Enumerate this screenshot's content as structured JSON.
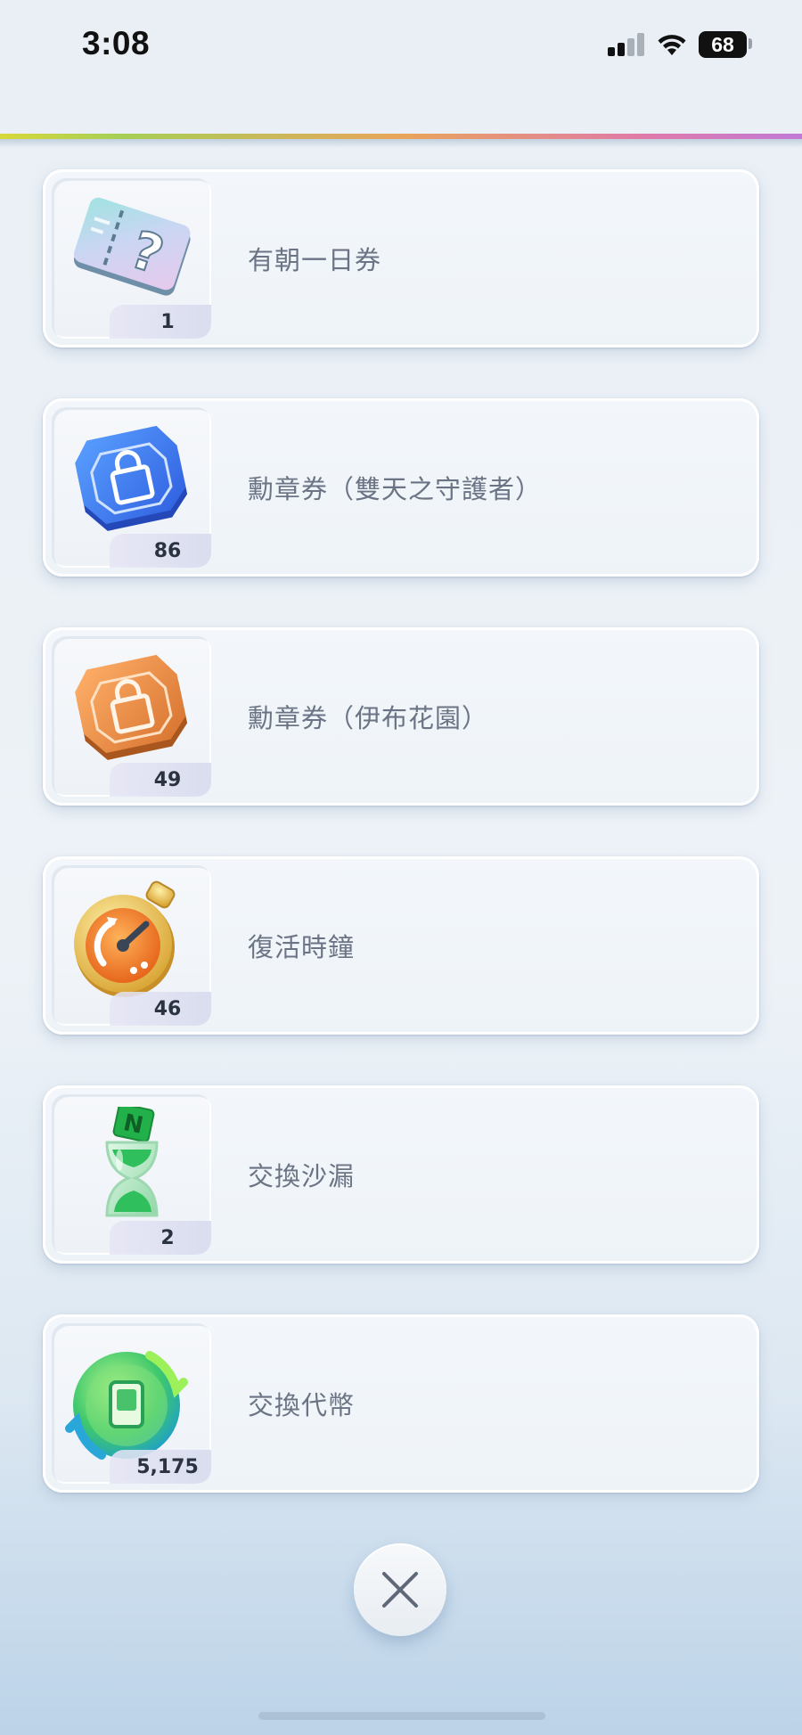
{
  "status_bar": {
    "time": "3:08",
    "battery": "68"
  },
  "items": [
    {
      "name": "有朝一日券",
      "count": "1",
      "icon": "mystery-ticket-icon"
    },
    {
      "name": "勳章券（雙天之守護者）",
      "count": "86",
      "icon": "blue-medal-ticket-icon"
    },
    {
      "name": "勳章券（伊布花園）",
      "count": "49",
      "icon": "orange-medal-ticket-icon"
    },
    {
      "name": "復活時鐘",
      "count": "46",
      "icon": "revival-clock-icon"
    },
    {
      "name": "交換沙漏",
      "count": "2",
      "icon": "exchange-hourglass-icon"
    },
    {
      "name": "交換代幣",
      "count": "5,175",
      "icon": "exchange-token-icon"
    }
  ],
  "colors": {
    "accent_rainbow": [
      "#d7d83a",
      "#e9a55a",
      "#c17ad6"
    ],
    "text": "#6b7484"
  }
}
